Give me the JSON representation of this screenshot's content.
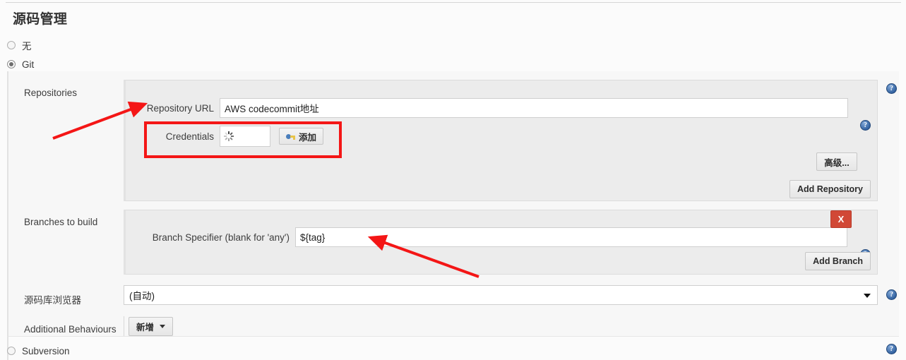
{
  "page": {
    "title": "源码管理"
  },
  "scm_options": [
    {
      "label": "无",
      "selected": false
    },
    {
      "label": "Git",
      "selected": true
    },
    {
      "label": "Subversion",
      "selected": false
    }
  ],
  "git": {
    "repositories": {
      "section_label": "Repositories",
      "url_label": "Repository URL",
      "url_value": "AWS codecommit地址",
      "url_placeholder": "",
      "credentials_label": "Credentials",
      "credentials_value": "",
      "credentials_state": "loading",
      "add_credentials_label": "添加",
      "advanced_label": "高级...",
      "add_repository_label": "Add Repository"
    },
    "branches": {
      "section_label": "Branches to build",
      "specifier_label": "Branch Specifier (blank for 'any')",
      "specifier_value": "${tag}",
      "delete_label": "X",
      "add_branch_label": "Add Branch"
    },
    "repository_browser": {
      "label": "源码库浏览器",
      "selected": "(自动)"
    },
    "additional_behaviours": {
      "label": "Additional Behaviours",
      "add_label": "新增"
    }
  },
  "help_icon": "?",
  "colors": {
    "accent_red": "#f41616",
    "delete_red": "#d14836",
    "help_blue": "#2f5f9e",
    "panel_bg": "#ececec",
    "body_bg": "#f7f7f7"
  }
}
